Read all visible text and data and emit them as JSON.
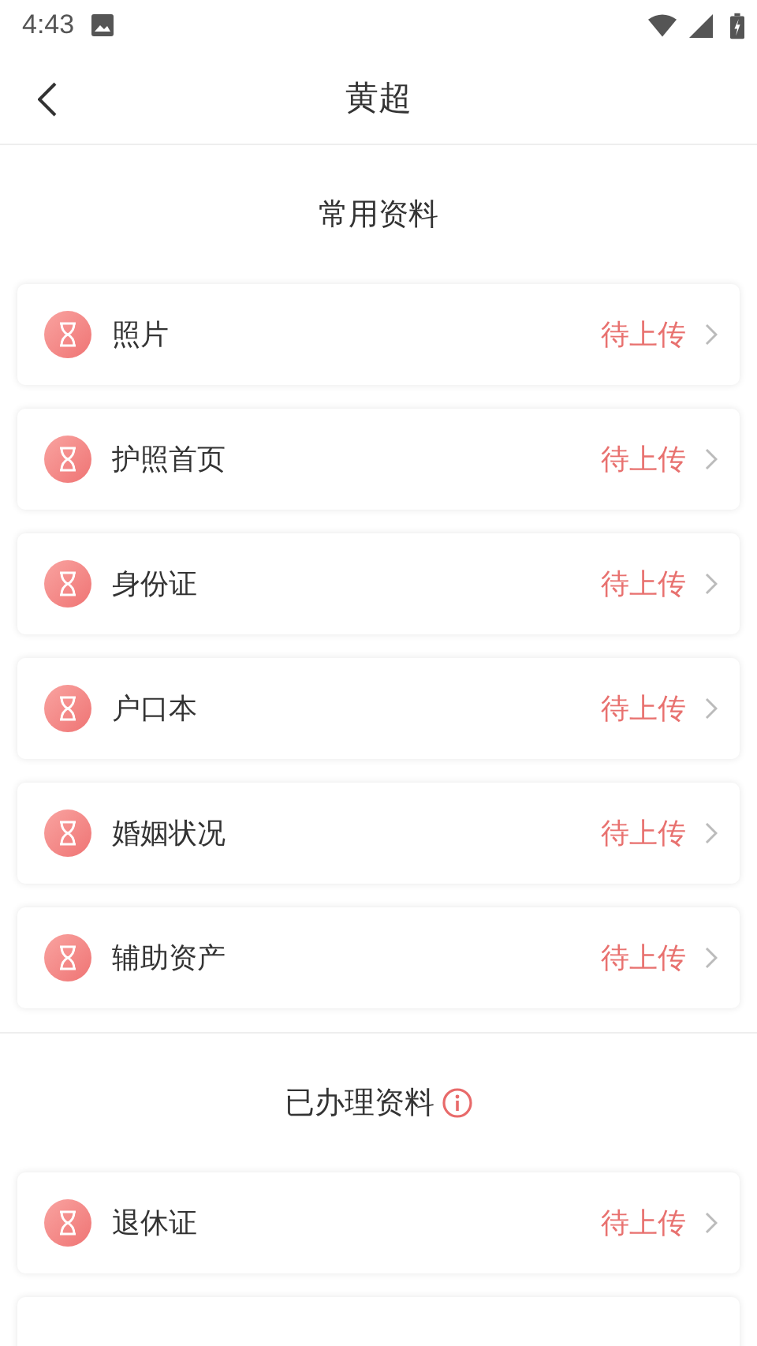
{
  "status_bar": {
    "time": "4:43"
  },
  "header": {
    "title": "黄超"
  },
  "sections": [
    {
      "title": "常用资料",
      "info": false,
      "items": [
        {
          "name": "照片",
          "status": "待上传"
        },
        {
          "name": "护照首页",
          "status": "待上传"
        },
        {
          "name": "身份证",
          "status": "待上传"
        },
        {
          "name": "户口本",
          "status": "待上传"
        },
        {
          "name": "婚姻状况",
          "status": "待上传"
        },
        {
          "name": "辅助资产",
          "status": "待上传"
        }
      ]
    },
    {
      "title": "已办理资料",
      "info": true,
      "items": [
        {
          "name": "退休证",
          "status": "待上传"
        }
      ]
    }
  ]
}
